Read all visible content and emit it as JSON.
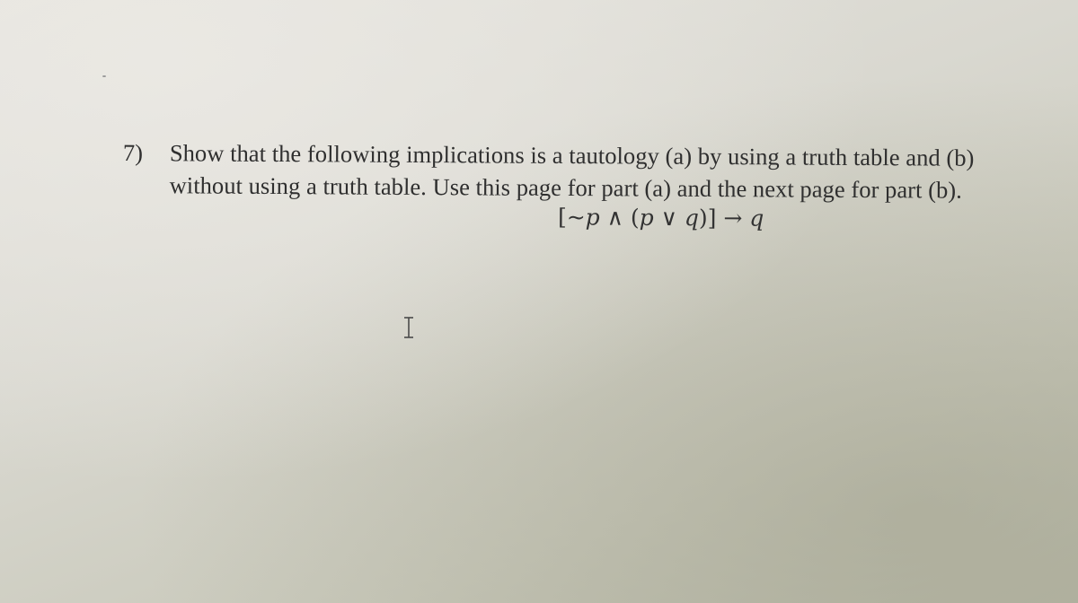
{
  "document": {
    "question": {
      "number": "7)",
      "line1": "Show that the following implications is a tautology (a) by using a truth table and (b)",
      "line2": "without using a truth table. Use this page for part (a) and the next page for part (b)."
    },
    "formula": {
      "open_bracket": "[",
      "negation": "~",
      "p1": "p",
      "and": " ∧ ",
      "open_paren": "(",
      "p2": "p",
      "or": " ∨ ",
      "q1": "q",
      "close": ")]",
      "implies": " → ",
      "q2": "q",
      "full_text": "[~p ∧ (p ∨ q)] → q"
    }
  },
  "cursor": {
    "icon": "text-ibeam-cursor-icon"
  }
}
